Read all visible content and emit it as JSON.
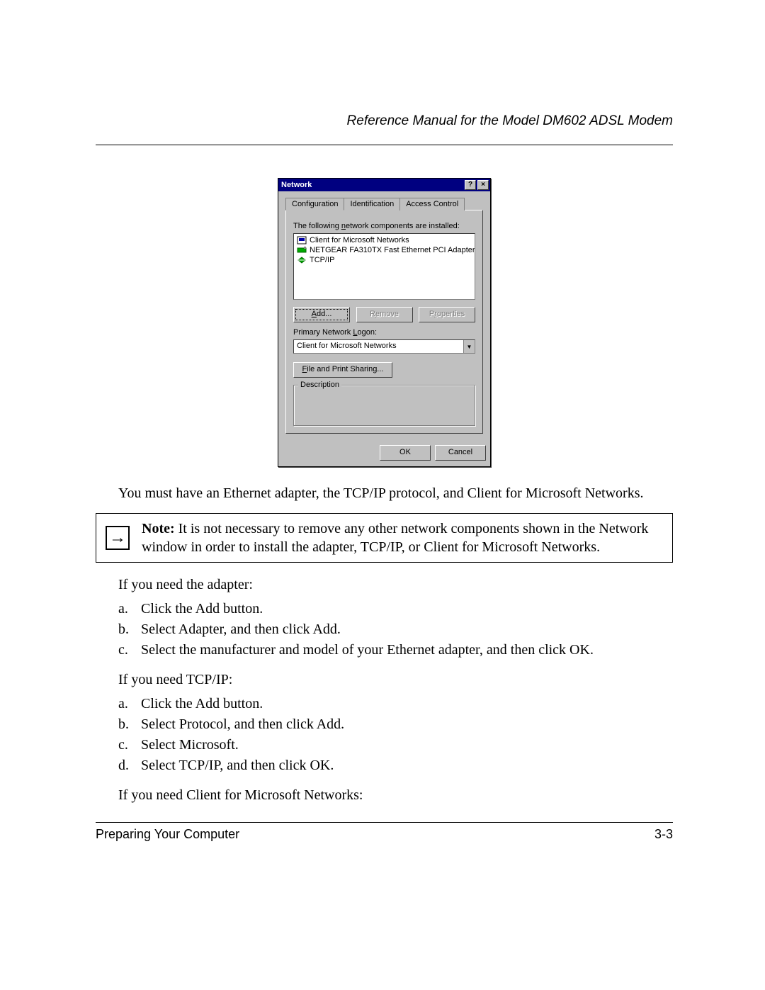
{
  "header": {
    "title": "Reference Manual for the Model DM602 ADSL Modem"
  },
  "dialog": {
    "title": "Network",
    "helpBtn": "?",
    "closeBtn": "×",
    "tabs": {
      "t0": "Configuration",
      "t1": "Identification",
      "t2": "Access Control"
    },
    "label_components_pre": "The following ",
    "label_components_ul": "n",
    "label_components_post": "etwork components are installed:",
    "list": {
      "i0": "Client for Microsoft Networks",
      "i1": "NETGEAR FA310TX Fast Ethernet PCI Adapter",
      "i2": "TCP/IP"
    },
    "btn_add_ul": "A",
    "btn_add_rest": "dd...",
    "btn_remove_pre": "R",
    "btn_remove_ul": "e",
    "btn_remove_post": "move",
    "btn_properties_pre": "P",
    "btn_properties_ul": "r",
    "btn_properties_post": "operties",
    "label_logon_pre": "Primary Network ",
    "label_logon_ul": "L",
    "label_logon_post": "ogon:",
    "combo_value": "Client for Microsoft Networks",
    "btn_file_ul": "F",
    "btn_file_rest": "ile and Print Sharing...",
    "group_desc": "Description",
    "btn_ok": "OK",
    "btn_cancel": "Cancel"
  },
  "body": {
    "p1": "You must have an Ethernet adapter, the TCP/IP protocol, and Client for Microsoft Networks.",
    "note_label": "Note:",
    "note_text": " It is not necessary to remove any other network components shown in the Network window in order to install the adapter, TCP/IP, or Client for Microsoft Networks.",
    "p2": "If you need the adapter:",
    "adapter": {
      "a": "Click the Add button.",
      "b": "Select Adapter, and then click Add.",
      "c": "Select the manufacturer and model of your Ethernet adapter, and then click OK."
    },
    "p3": "If you need TCP/IP:",
    "tcpip": {
      "a": "Click the Add button.",
      "b": "Select Protocol, and then click Add.",
      "c": "Select Microsoft.",
      "d": "Select TCP/IP, and then click OK."
    },
    "p4": "If you need Client for Microsoft Networks:"
  },
  "footer": {
    "left": "Preparing Your Computer",
    "right": "3-3"
  },
  "markers": {
    "a": "a.",
    "b": "b.",
    "c": "c.",
    "d": "d."
  },
  "icons": {
    "arrow": "→",
    "dropdown": "▼"
  }
}
